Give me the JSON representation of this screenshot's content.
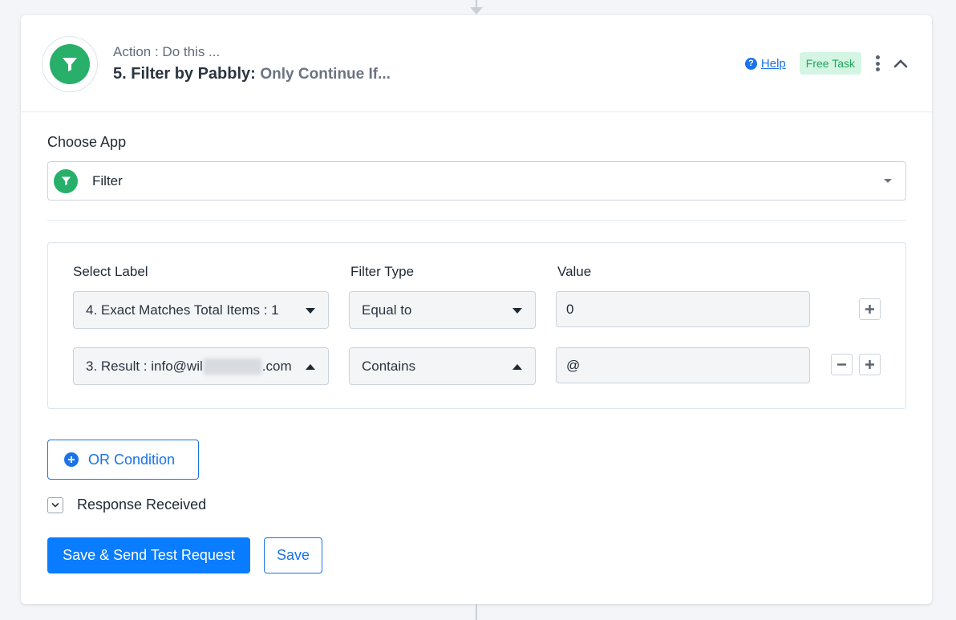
{
  "header": {
    "subtitle": "Action : Do this ...",
    "step_title": "5. Filter by Pabbly:",
    "step_event": "Only Continue If...",
    "help_label": "Help",
    "badge": "Free Task",
    "accent_color": "#28b06b"
  },
  "choose_app": {
    "label": "Choose App",
    "selected": "Filter"
  },
  "filter": {
    "columns": [
      "Select Label",
      "Filter Type",
      "Value"
    ],
    "rows": [
      {
        "label": "4. Exact Matches Total Items : 1",
        "type": "Equal to",
        "value": "0"
      },
      {
        "label_prefix": "3. Result : info@wil",
        "label_suffix": ".com",
        "type": "Contains",
        "value": "@"
      }
    ]
  },
  "or_condition": "OR Condition",
  "response": {
    "label": "Response Received"
  },
  "actions": {
    "primary": "Save & Send Test Request",
    "secondary": "Save"
  }
}
